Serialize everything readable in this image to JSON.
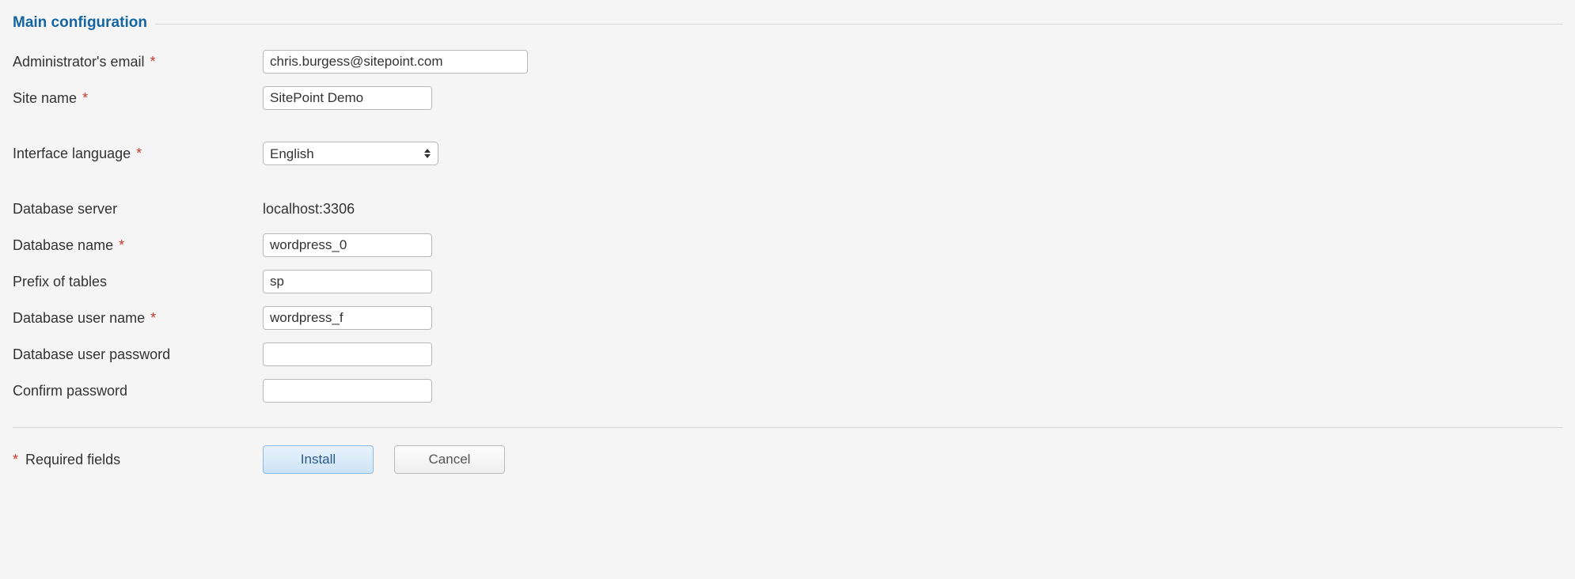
{
  "fieldset": {
    "legend": "Main configuration"
  },
  "labels": {
    "admin_email": "Administrator's email",
    "site_name": "Site name",
    "interface_language": "Interface language",
    "db_server": "Database server",
    "db_name": "Database name",
    "prefix_tables": "Prefix of tables",
    "db_user_name": "Database user name",
    "db_user_password": "Database user password",
    "confirm_password": "Confirm password",
    "required_fields": "Required fields"
  },
  "values": {
    "admin_email": "chris.burgess@sitepoint.com",
    "site_name": "SitePoint Demo",
    "interface_language": "English",
    "db_server": "localhost:3306",
    "db_name": "wordpress_0",
    "prefix_tables": "sp",
    "db_user_name": "wordpress_f",
    "db_user_password": "",
    "confirm_password": ""
  },
  "symbols": {
    "star": "*"
  },
  "buttons": {
    "install": "Install",
    "cancel": "Cancel"
  }
}
